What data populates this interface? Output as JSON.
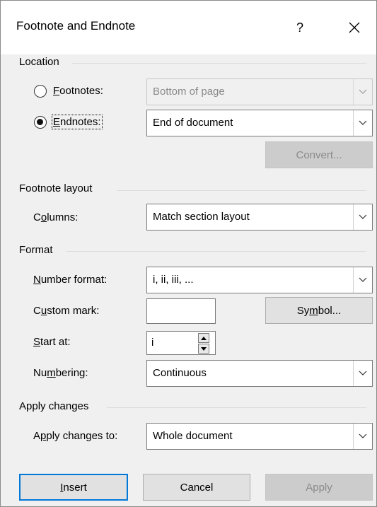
{
  "dialog": {
    "title": "Footnote and Endnote",
    "help_glyph": "?"
  },
  "location": {
    "heading": "Location",
    "footnotes": {
      "label_key": "F",
      "label_rest": "ootnotes:",
      "value": "Bottom of page",
      "checked": false
    },
    "endnotes": {
      "label_key": "E",
      "label_rest": "ndnotes:",
      "value": "End of document",
      "checked": true
    },
    "convert_label": "Convert..."
  },
  "footnote_layout": {
    "heading": "Footnote layout",
    "columns_pre": "C",
    "columns_key": "o",
    "columns_post": "lumns:",
    "columns_value": "Match section layout"
  },
  "format": {
    "heading": "Format",
    "number_format_key": "N",
    "number_format_rest": "umber format:",
    "number_format_value": "i, ii, iii, ...",
    "custom_mark_pre": "C",
    "custom_mark_key": "u",
    "custom_mark_post": "stom mark:",
    "custom_mark_value": "",
    "symbol_pre": "Sy",
    "symbol_key": "m",
    "symbol_post": "bol...",
    "start_at_key": "S",
    "start_at_rest": "tart at:",
    "start_at_value": "i",
    "numbering_pre": "Nu",
    "numbering_key": "m",
    "numbering_post": "bering:",
    "numbering_value": "Continuous"
  },
  "apply_changes": {
    "heading": "Apply changes",
    "apply_to_pre": "A",
    "apply_to_key": "p",
    "apply_to_post": "ply changes to:",
    "apply_to_value": "Whole document"
  },
  "buttons": {
    "insert_key": "I",
    "insert_rest": "nsert",
    "cancel": "Cancel",
    "apply": "Apply"
  },
  "colors": {
    "accent": "#0078d7",
    "dialog_bg": "#f0f0f0",
    "disabled_text": "#8a8a8a"
  },
  "icons": {
    "close": "close-icon",
    "dropdown": "chevron-down-icon",
    "spin_up": "spin-up-icon",
    "spin_down": "spin-down-icon"
  }
}
